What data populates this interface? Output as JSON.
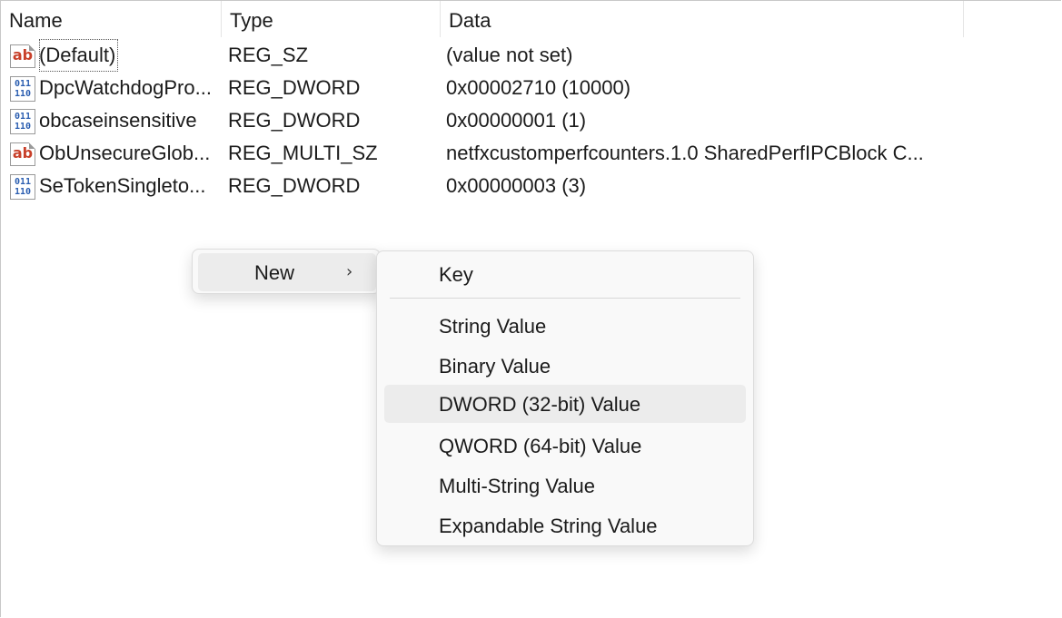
{
  "columns": {
    "name": "Name",
    "type": "Type",
    "data": "Data"
  },
  "rows": [
    {
      "icon": "string-value-icon",
      "name": "(Default)",
      "type": "REG_SZ",
      "data": "(value not set)"
    },
    {
      "icon": "binary-value-icon",
      "name": "DpcWatchdogPro...",
      "type": "REG_DWORD",
      "data": "0x00002710 (10000)"
    },
    {
      "icon": "binary-value-icon",
      "name": "obcaseinsensitive",
      "type": "REG_DWORD",
      "data": "0x00000001 (1)"
    },
    {
      "icon": "string-value-icon",
      "name": "ObUnsecureGlob...",
      "type": "REG_MULTI_SZ",
      "data": "netfxcustomperfcounters.1.0 SharedPerfIPCBlock C..."
    },
    {
      "icon": "binary-value-icon",
      "name": "SeTokenSingleto...",
      "type": "REG_DWORD",
      "data": "0x00000003 (3)"
    }
  ],
  "icons": {
    "string_glyph": "ab",
    "binary_glyph_top": "011",
    "binary_glyph_bottom": "110"
  },
  "context_menu": {
    "new_label": "New",
    "arrow": "›"
  },
  "submenu": {
    "key": "Key",
    "items": [
      "String Value",
      "Binary Value",
      "DWORD (32-bit) Value",
      "QWORD (64-bit) Value",
      "Multi-String Value",
      "Expandable String Value"
    ],
    "hovered": "DWORD (32-bit) Value"
  }
}
